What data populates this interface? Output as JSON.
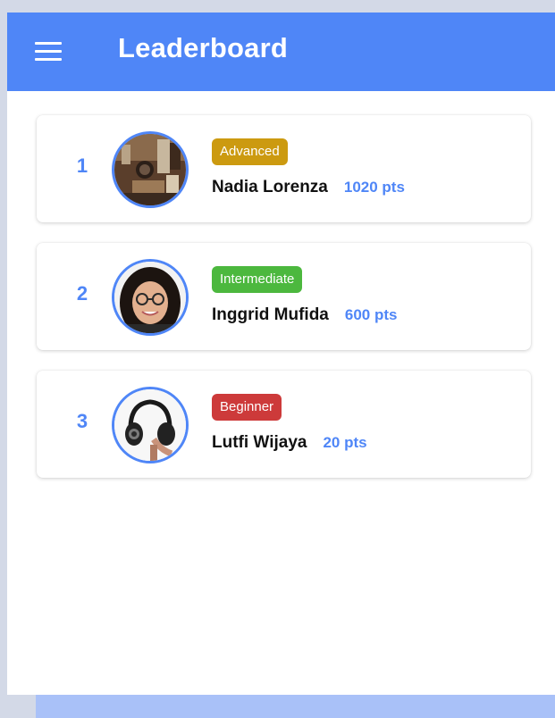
{
  "app_bar": {
    "title": "Leaderboard",
    "menu_icon": "hamburger-menu-icon"
  },
  "colors": {
    "primary": "#4f86f7",
    "advanced": "#cc9a10",
    "intermediate": "#4cb83e",
    "beginner": "#cd3a3a"
  },
  "leaderboard": [
    {
      "rank": "1",
      "level": "Advanced",
      "level_color": "#cc9a10",
      "name": "Nadia Lorenza",
      "points": "1020 pts",
      "avatar": "room-photo-avatar"
    },
    {
      "rank": "2",
      "level": "Intermediate",
      "level_color": "#4cb83e",
      "name": "Inggrid Mufida",
      "points": "600 pts",
      "avatar": "woman-with-glasses-avatar"
    },
    {
      "rank": "3",
      "level": "Beginner",
      "level_color": "#cd3a3a",
      "name": "Lutfi Wijaya",
      "points": "20 pts",
      "avatar": "headphones-avatar"
    }
  ]
}
